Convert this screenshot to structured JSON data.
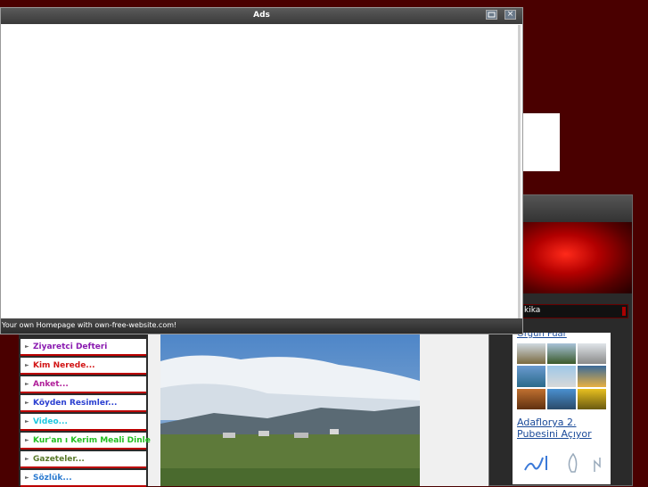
{
  "ads_window": {
    "title": "Ads",
    "footer_text": "Your own Homepage with own-free-website.com!",
    "icons": [
      "maximize-icon",
      "close-icon"
    ],
    "close_glyph": "×"
  },
  "right_sidebar": {
    "bar_label": "kika",
    "partial_link": "Orgun Fuar",
    "link_lines": [
      "Adaflorya 2.",
      "Pubesini Açıyor"
    ],
    "logo_glyphs": [
      "ᨀ",
      "🜂",
      "🜄"
    ]
  },
  "left_nav": {
    "items": [
      {
        "label": "Ziyaretci Defteri",
        "color": "#8a1ab0"
      },
      {
        "label": "Kim Nerede...",
        "color": "#d21414"
      },
      {
        "label": "Anket...",
        "color": "#b0209a"
      },
      {
        "label": "Köyden Resimler...",
        "color": "#2a3fd0"
      },
      {
        "label": "Video...",
        "color": "#20c8e0"
      },
      {
        "label": "Kur'an ı Kerim Meali Dinle",
        "color": "#22c020"
      },
      {
        "label": "Gazeteler...",
        "color": "#5a7a2a"
      },
      {
        "label": "Sözlük...",
        "color": "#2a7ad0"
      }
    ]
  },
  "colors": {
    "page_background": "#4a0000",
    "nav_border": "#bb0000"
  }
}
